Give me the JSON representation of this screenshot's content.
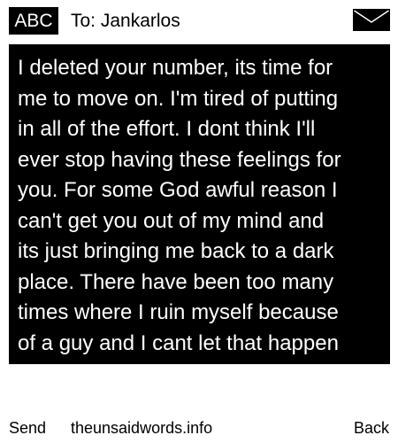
{
  "header": {
    "badge": "ABC",
    "recipient": "To: Jankarlos",
    "envelope_icon": "envelope-icon"
  },
  "message": {
    "lines": [
      "I deleted your number, its time for",
      "me to move on. I'm tired of putting",
      "in all of the effort. I dont think I'll",
      "ever stop having these feelings for",
      "you. For some God awful reason I",
      "can't get you out of my mind and",
      "its just bringing me back to a dark",
      "place. There have been too many",
      "times where I ruin myself because",
      "of a guy and I cant let that happen"
    ]
  },
  "footer": {
    "send_label": "Send",
    "site_label": "theunsaidwords.info",
    "back_label": "Back"
  },
  "colors": {
    "background": "#ffffff",
    "message_background": "#000000",
    "message_text": "#ffffff"
  }
}
